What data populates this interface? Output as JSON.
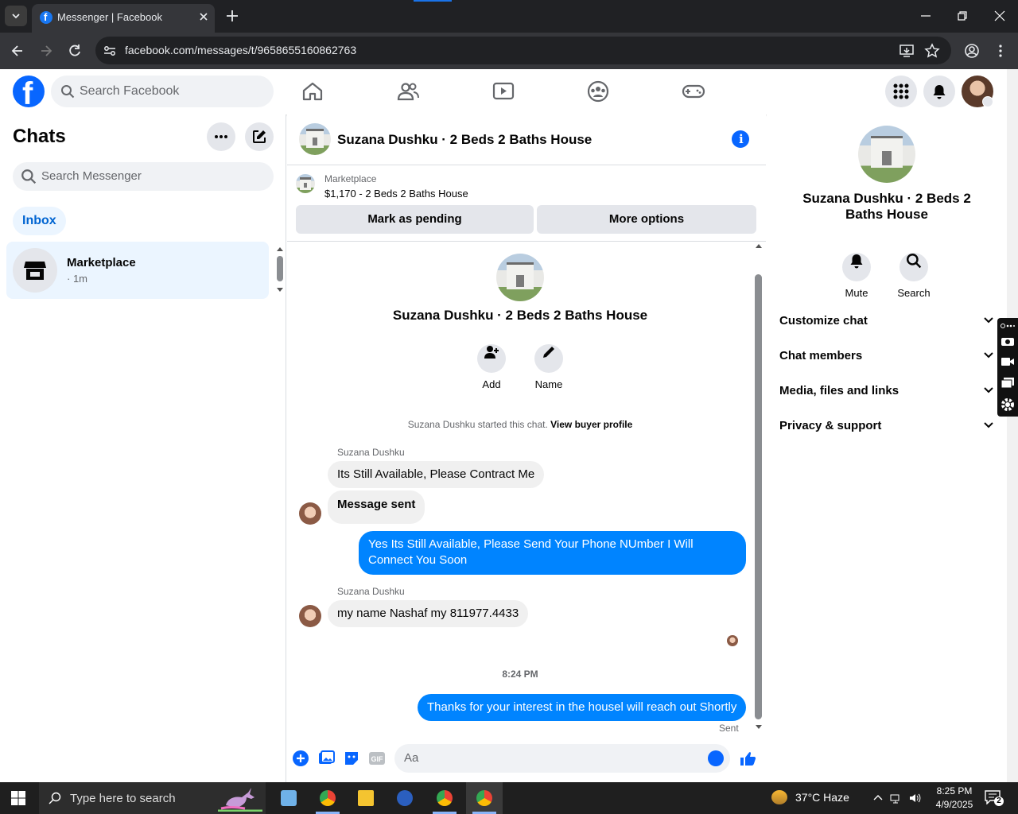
{
  "browser": {
    "tab_title": "Messenger | Facebook",
    "url": "facebook.com/messages/t/9658655160862763"
  },
  "fb_header": {
    "search_placeholder": "Search Facebook"
  },
  "left": {
    "title": "Chats",
    "search_placeholder": "Search Messenger",
    "filter_label": "Inbox",
    "chats": [
      {
        "name": "Marketplace",
        "meta": "· 1m"
      }
    ]
  },
  "conversation": {
    "title": "Suzana Dushku · 2 Beds 2 Baths House",
    "marketplace_label": "Marketplace",
    "listing": "$1,170 - 2 Beds 2 Baths House",
    "mark_pending_label": "Mark as pending",
    "more_options_label": "More options",
    "intro_name": "Suzana Dushku · 2 Beds 2 Baths House",
    "add_label": "Add",
    "name_label": "Name",
    "system_text": "Suzana Dushku started this chat.",
    "system_link": "View buyer profile",
    "sender_name": "Suzana Dushku",
    "messages": [
      {
        "text": "Its Still Available, Please Contract Me",
        "dir": "in"
      },
      {
        "text": "Message sent",
        "dir": "in"
      },
      {
        "text": "Yes Its Still Available, Please Send Your Phone NUmber I Will Connect You Soon",
        "dir": "out"
      },
      {
        "text": "my name Nashaf my 811977.4433",
        "dir": "in"
      },
      {
        "text": "Thanks for your interest in the housel will reach out Shortly",
        "dir": "out"
      }
    ],
    "timestamp": "8:24 PM",
    "sent_label": "Sent",
    "composer_placeholder": "Aa"
  },
  "right_panel": {
    "name": "Suzana Dushku · 2 Beds 2 Baths House",
    "mute_label": "Mute",
    "search_label": "Search",
    "sections": [
      "Customize chat",
      "Chat members",
      "Media, files and links",
      "Privacy & support"
    ]
  },
  "taskbar": {
    "search_placeholder": "Type here to search",
    "weather": "37°C  Haze",
    "time": "8:25 PM",
    "date": "4/9/2025",
    "notification_count": "2"
  },
  "colors": {
    "fb_blue": "#0866ff",
    "outgoing_bubble": "#0084ff",
    "incoming_bubble": "#f0f0f0",
    "selected_chat": "#ebf5ff"
  }
}
